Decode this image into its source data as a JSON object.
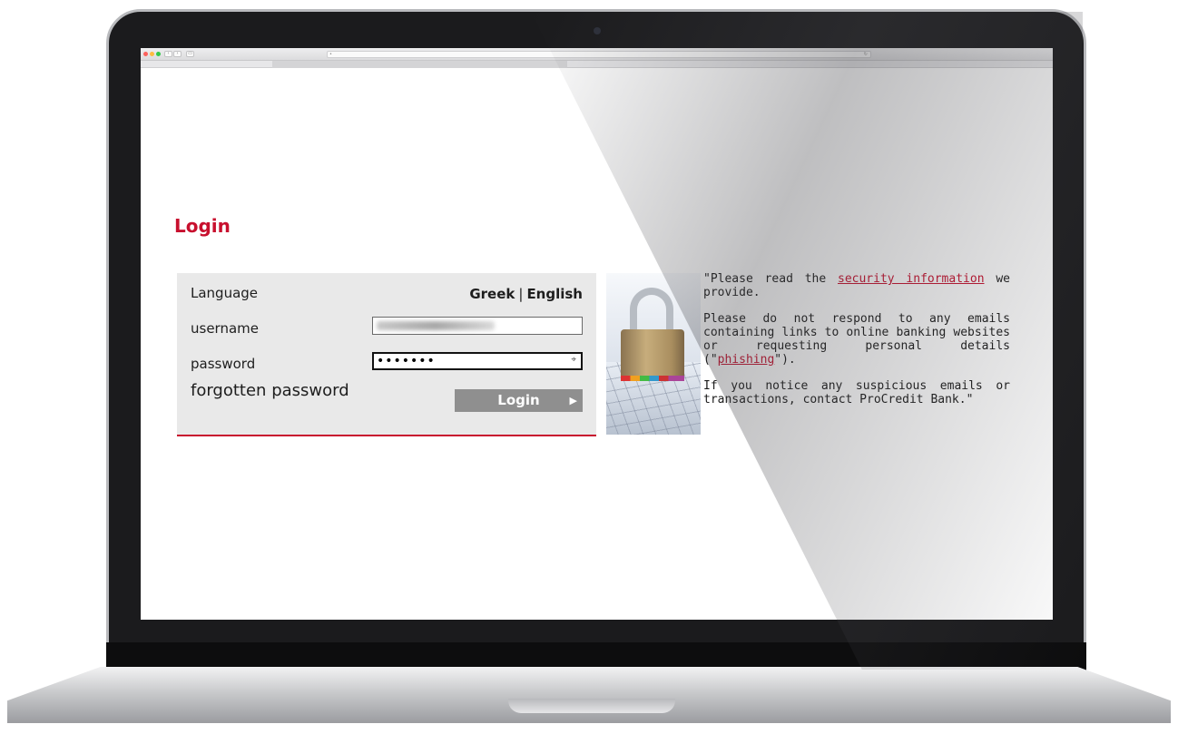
{
  "page": {
    "title": "Login"
  },
  "login_form": {
    "language_label": "Language",
    "language_options": [
      "Greek",
      "English"
    ],
    "language_separator": "|",
    "username_label": "username",
    "password_label": "password",
    "password_value": "•••••••",
    "forgotten_password_label": "forgotten password",
    "login_button_label": "Login"
  },
  "security_notice": {
    "para1_before": "\"Please read the ",
    "para1_link": "security information",
    "para1_after": " we provide.",
    "para2_before": "Please do not respond to any emails containing links to online banking websites or requesting personal details (\"",
    "para2_link": "phishing",
    "para2_after": "\").",
    "para3": "If you notice any suspicious emails or transactions, contact ProCredit Bank.\""
  },
  "colors": {
    "accent": "#c8102e",
    "panel_bg": "#e9e9e9",
    "button_bg": "#8f8f8f"
  },
  "icons": [
    "padlock-image",
    "key-icon",
    "chevron-right-icon"
  ]
}
